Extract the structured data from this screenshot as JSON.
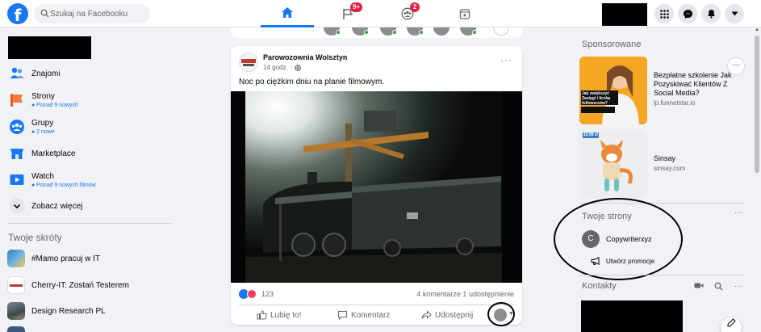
{
  "header": {
    "search_placeholder": "Szukaj na Facebooku",
    "nav_tabs": [
      {
        "name": "home",
        "active": true
      },
      {
        "name": "pages",
        "badge": "9+"
      },
      {
        "name": "groups",
        "badge": "2"
      },
      {
        "name": "gaming"
      }
    ]
  },
  "sidebar": {
    "items": [
      {
        "label": "Znajomi",
        "sub": ""
      },
      {
        "label": "Strony",
        "sub": "● Ponad 9 nowych"
      },
      {
        "label": "Grupy",
        "sub": "● 2 nowe"
      },
      {
        "label": "Marketplace",
        "sub": ""
      },
      {
        "label": "Watch",
        "sub": "● Ponad 9 nowych filmów"
      },
      {
        "label": "Zobacz więcej",
        "sub": ""
      }
    ],
    "shortcuts_title": "Twoje skróty",
    "shortcuts": [
      {
        "label": "#Mamo pracuj w IT"
      },
      {
        "label": "Cherry-IT: Zostań Testerem"
      },
      {
        "label": "Design Research PL"
      }
    ]
  },
  "post": {
    "author": "Parowozownia Wolsztyn",
    "time": "14 godz.",
    "dot": "·",
    "text": "Noc po ciężkim dniu na planie filmowym.",
    "reaction_count": "123",
    "stats": "4 komentarze  1 udostępnienie",
    "like_label": "Lubię to!",
    "comment_label": "Komentarz",
    "share_label": "Udostępnij",
    "more": "···"
  },
  "right": {
    "sponsored_title": "Sponsorowane",
    "ads": [
      {
        "title": "Bezpłatne szkolenie Jak Pozyskiwać Klientów Z Social Media?",
        "url": "lp.funnelstar.io",
        "img_caption": "Jak zwiększyć Zasięgi i liczbę followersów?"
      },
      {
        "title": "Sinsay",
        "url": "sinsay.com",
        "price_tag": "19,99 zł"
      }
    ],
    "ad_more": "···",
    "pages_title": "Twoje strony",
    "pages_more": "···",
    "page_initial": "C",
    "page_name": "Copywriterxyz",
    "promo_label": "Utwórz promocje",
    "contacts_title": "Kontakty",
    "contacts_more": "···"
  },
  "colors": {
    "brand": "#1877f2",
    "badge": "#e41e3f",
    "online": "#31a24c"
  }
}
